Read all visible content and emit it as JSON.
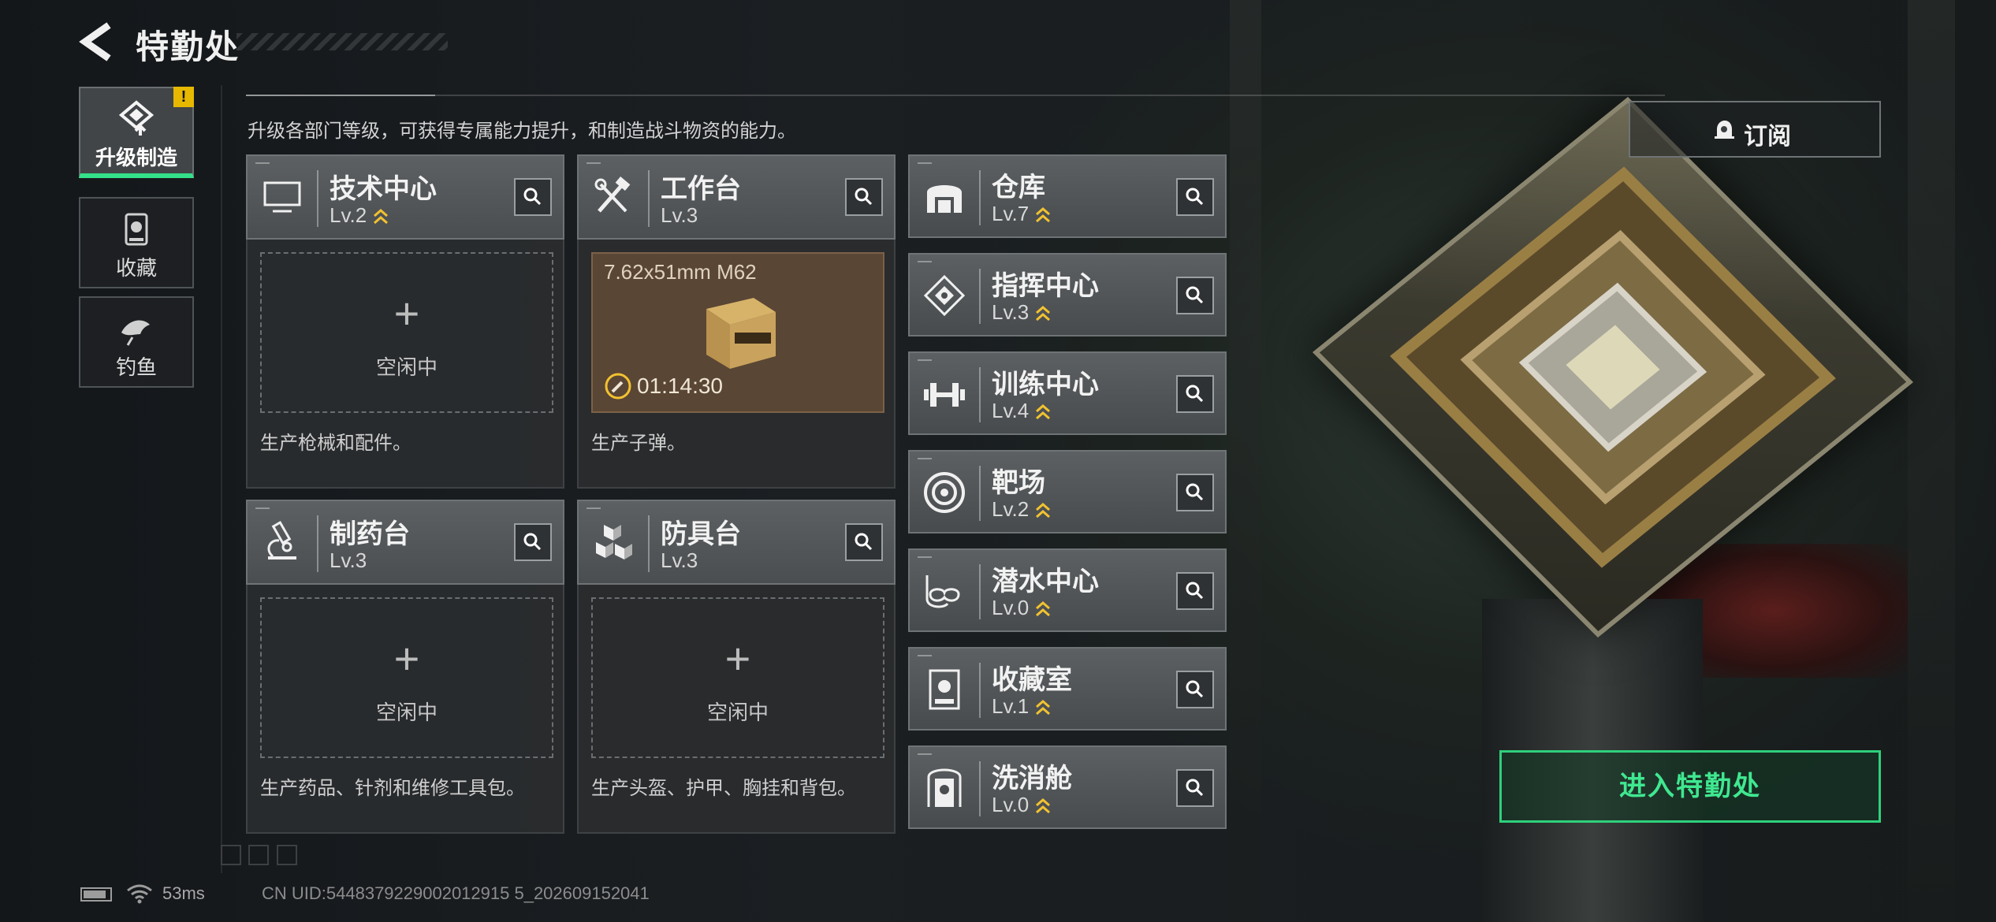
{
  "header": {
    "title": "特勤处",
    "subtitle": "升级各部门等级，可获得专属能力提升，和制造战斗物资的能力。"
  },
  "nav": {
    "items": [
      {
        "label": "升级制造",
        "active": true,
        "badge": "!"
      },
      {
        "label": "收藏",
        "active": false
      },
      {
        "label": "钓鱼",
        "active": false
      }
    ]
  },
  "production": [
    {
      "name": "技术中心",
      "level": "Lv.2",
      "upgradable": true,
      "slot": {
        "state": "idle",
        "idle_text": "空闲中"
      },
      "desc": "生产枪械和配件。"
    },
    {
      "name": "工作台",
      "level": "Lv.3",
      "upgradable": false,
      "slot": {
        "state": "busy",
        "item": "7.62x51mm M62",
        "timer": "01:14:30"
      },
      "desc": "生产子弹。"
    },
    {
      "name": "制药台",
      "level": "Lv.3",
      "upgradable": false,
      "slot": {
        "state": "idle",
        "idle_text": "空闲中"
      },
      "desc": "生产药品、针剂和维修工具包。"
    },
    {
      "name": "防具台",
      "level": "Lv.3",
      "upgradable": false,
      "slot": {
        "state": "idle",
        "idle_text": "空闲中"
      },
      "desc": "生产头盔、护甲、胸挂和背包。"
    }
  ],
  "facilities": [
    {
      "name": "仓库",
      "level": "Lv.7",
      "upgradable": true,
      "icon": "warehouse-icon"
    },
    {
      "name": "指挥中心",
      "level": "Lv.3",
      "upgradable": true,
      "icon": "command-center-icon"
    },
    {
      "name": "训练中心",
      "level": "Lv.4",
      "upgradable": true,
      "icon": "dumbbell-icon"
    },
    {
      "name": "靶场",
      "level": "Lv.2",
      "upgradable": true,
      "icon": "target-icon"
    },
    {
      "name": "潜水中心",
      "level": "Lv.0",
      "upgradable": true,
      "icon": "diving-mask-icon"
    },
    {
      "name": "收藏室",
      "level": "Lv.1",
      "upgradable": true,
      "icon": "collection-room-icon"
    },
    {
      "name": "洗消舱",
      "level": "Lv.0",
      "upgradable": true,
      "icon": "decontamination-icon"
    }
  ],
  "actions": {
    "subscribe_label": "订阅",
    "enter_label": "进入特勤处"
  },
  "status": {
    "ping": "53ms",
    "uid": "CN UID:5448379229002012915 5_202609152041"
  },
  "colors": {
    "accent_green": "#35e08a",
    "upgrade_yellow": "#f2c230",
    "badge_yellow": "#e6b800"
  }
}
